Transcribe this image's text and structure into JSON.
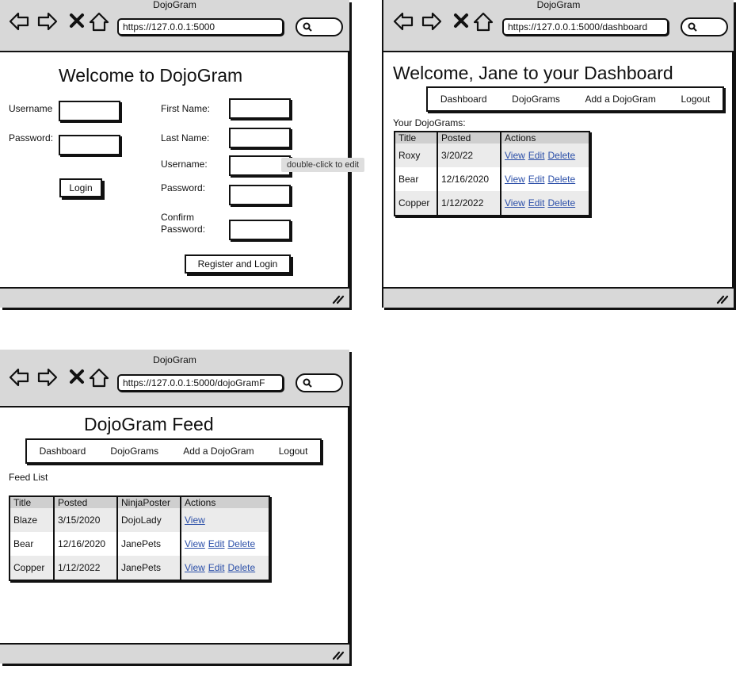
{
  "login_window": {
    "title": "DojoGram",
    "url": "https://127.0.0.1:5000",
    "heading": "Welcome to DojoGram",
    "username_label": "Username",
    "password_label": "Password:",
    "login_button": "Login",
    "first_name_label": "First Name:",
    "last_name_label": "Last Name:",
    "reg_username_label": "Username:",
    "reg_password_label": "Password:",
    "confirm_label_1": "Confirm",
    "confirm_label_2": "Password:",
    "register_button": "Register and Login",
    "tooltip": "double-click to edit"
  },
  "dashboard_window": {
    "title": "DojoGram",
    "url": "https://127.0.0.1:5000/dashboard",
    "heading": "Welcome, Jane to your Dashboard",
    "menu": [
      "Dashboard",
      "DojoGrams",
      "Add a DojoGram",
      "Logout"
    ],
    "section_label": "Your DojoGrams:",
    "columns": [
      "Title",
      "Posted",
      "Actions"
    ],
    "rows": [
      {
        "title": "Roxy",
        "posted": "3/20/22",
        "actions": [
          "View",
          "Edit",
          "Delete"
        ]
      },
      {
        "title": "Bear",
        "posted": "12/16/2020",
        "actions": [
          "View",
          "Edit",
          "Delete"
        ]
      },
      {
        "title": "Copper",
        "posted": "1/12/2022",
        "actions": [
          "View",
          "Edit",
          "Delete"
        ]
      }
    ]
  },
  "feed_window": {
    "title": "DojoGram",
    "url": "https://127.0.0.1:5000/dojoGramF",
    "heading": "DojoGram Feed",
    "menu": [
      "Dashboard",
      "DojoGrams",
      "Add a DojoGram",
      "Logout"
    ],
    "section_label": "Feed List",
    "columns": [
      "Title",
      "Posted",
      "NinjaPoster",
      "Actions"
    ],
    "rows": [
      {
        "title": "Blaze",
        "posted": "3/15/2020",
        "poster": "DojoLady",
        "actions": [
          "View"
        ]
      },
      {
        "title": "Bear",
        "posted": "12/16/2020",
        "poster": "JanePets",
        "actions": [
          "View",
          "Edit",
          "Delete"
        ]
      },
      {
        "title": "Copper",
        "posted": "1/12/2022",
        "poster": "JanePets",
        "actions": [
          "View",
          "Edit",
          "Delete"
        ]
      }
    ]
  },
  "icons": [
    "back-arrow-icon",
    "forward-arrow-icon",
    "stop-x-icon",
    "home-icon",
    "search-icon",
    "resize-grip-icon"
  ]
}
